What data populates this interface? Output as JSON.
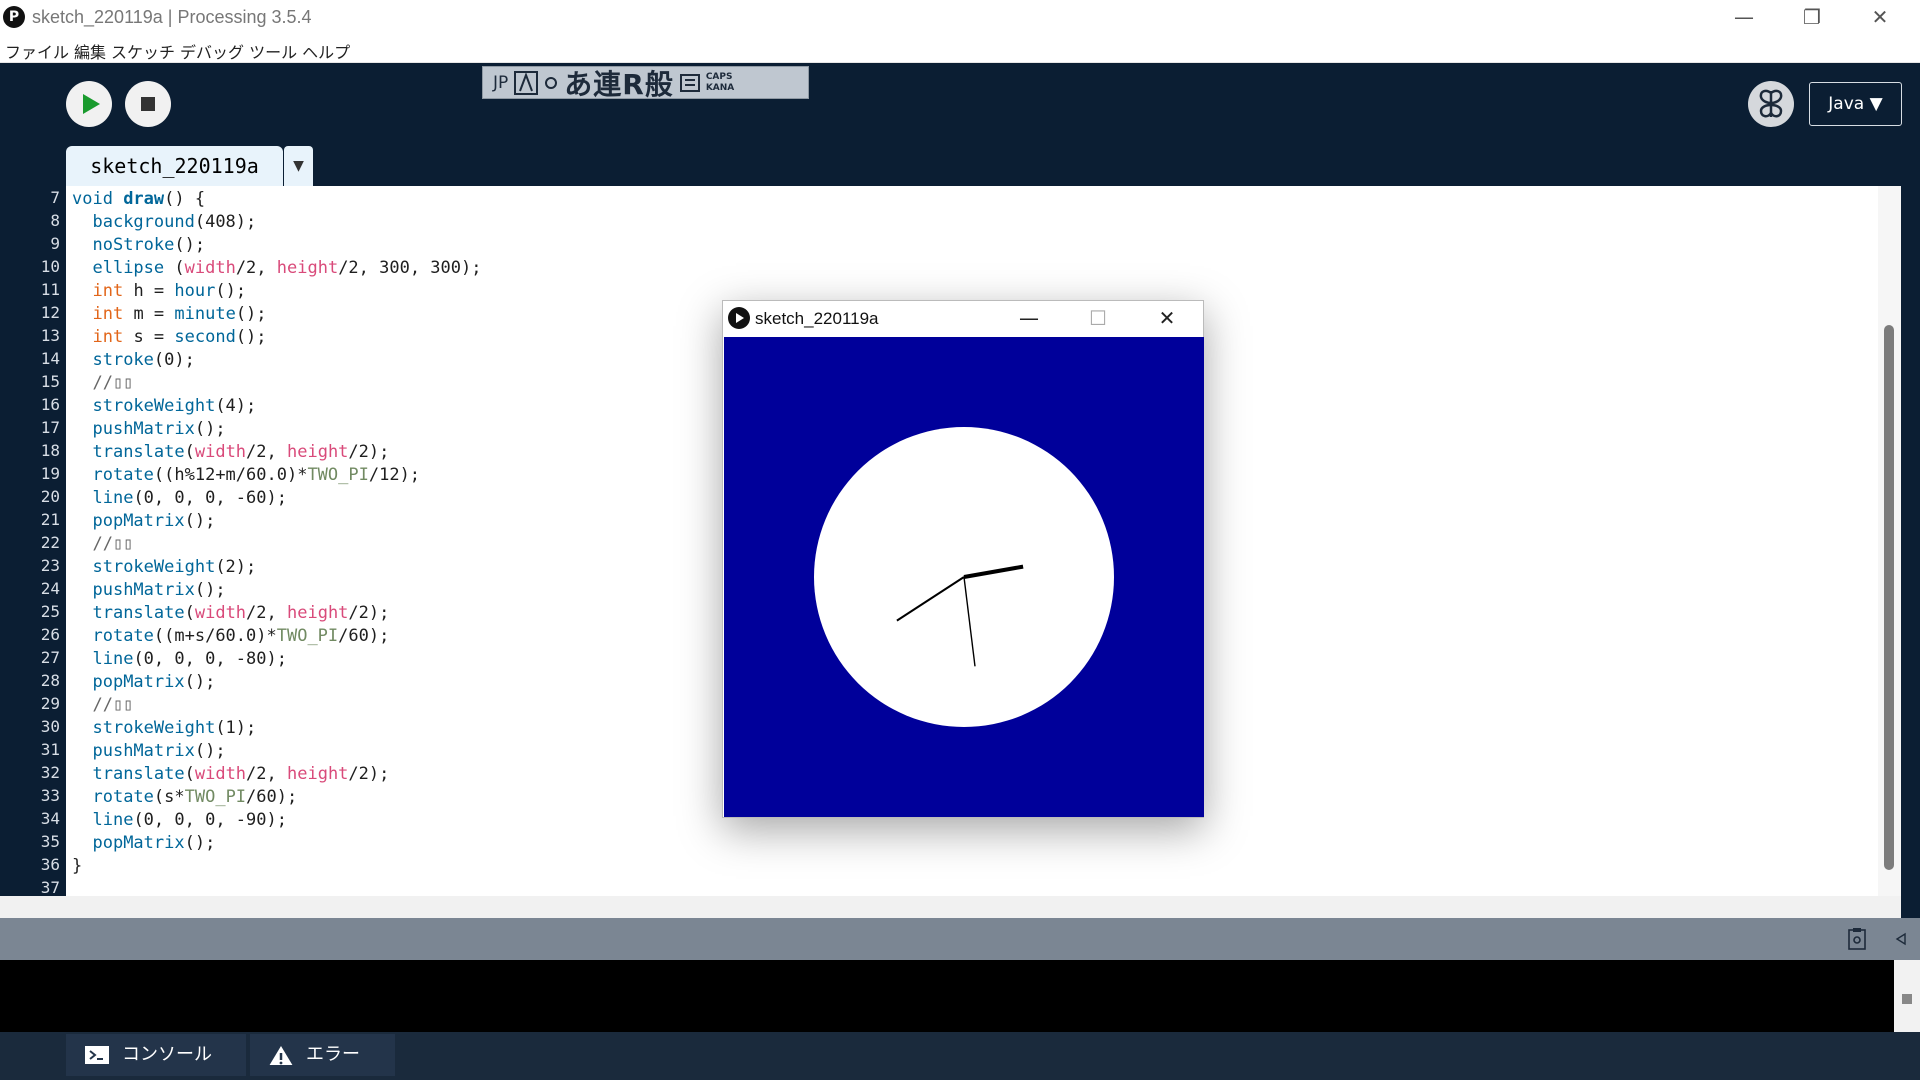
{
  "window": {
    "app_icon": "P",
    "title": "sketch_220119a | Processing 3.5.4",
    "minimize": "—",
    "restore": "❐",
    "close": "✕"
  },
  "menu": [
    "ファイル",
    "編集",
    "スケッチ",
    "デバッグ",
    "ツール",
    "ヘルプ"
  ],
  "toolbar": {
    "run_icon": "play-icon",
    "stop_icon": "stop-icon",
    "mode": "Java ▼",
    "debug_icon": "butterfly-icon"
  },
  "ime": {
    "lang": "JP",
    "mode_chars": "あ連R般",
    "caps": "CAPS",
    "kana": "KANA"
  },
  "tab": {
    "name": "sketch_220119a",
    "menu": "▼"
  },
  "editor": {
    "line_numbers": [
      "7",
      "8",
      "9",
      "10",
      "11",
      "12",
      "13",
      "14",
      "15",
      "16",
      "17",
      "18",
      "19",
      "20",
      "21",
      "22",
      "23",
      "24",
      "25",
      "26",
      "27",
      "28",
      "29",
      "30",
      "31",
      "32",
      "33",
      "34",
      "35",
      "36",
      "37"
    ],
    "lines": [
      [
        {
          "t": "void ",
          "c": "fn"
        },
        {
          "t": "draw",
          "c": "def"
        },
        {
          "t": "() {",
          "c": ""
        }
      ],
      [
        {
          "t": "  ",
          "c": ""
        },
        {
          "t": "background",
          "c": "fn"
        },
        {
          "t": "(408);",
          "c": ""
        }
      ],
      [
        {
          "t": "  ",
          "c": ""
        },
        {
          "t": "noStroke",
          "c": "fn"
        },
        {
          "t": "();",
          "c": ""
        }
      ],
      [
        {
          "t": "  ",
          "c": ""
        },
        {
          "t": "ellipse",
          "c": "fn"
        },
        {
          "t": " (",
          "c": ""
        },
        {
          "t": "width",
          "c": "var"
        },
        {
          "t": "/2, ",
          "c": ""
        },
        {
          "t": "height",
          "c": "var"
        },
        {
          "t": "/2, 300, 300);",
          "c": ""
        }
      ],
      [
        {
          "t": "  ",
          "c": ""
        },
        {
          "t": "int",
          "c": "kw"
        },
        {
          "t": " h = ",
          "c": ""
        },
        {
          "t": "hour",
          "c": "fn"
        },
        {
          "t": "();",
          "c": ""
        }
      ],
      [
        {
          "t": "  ",
          "c": ""
        },
        {
          "t": "int",
          "c": "kw"
        },
        {
          "t": " m = ",
          "c": ""
        },
        {
          "t": "minute",
          "c": "fn"
        },
        {
          "t": "();",
          "c": ""
        }
      ],
      [
        {
          "t": "  ",
          "c": ""
        },
        {
          "t": "int",
          "c": "kw"
        },
        {
          "t": " s = ",
          "c": ""
        },
        {
          "t": "second",
          "c": "fn"
        },
        {
          "t": "();",
          "c": ""
        }
      ],
      [
        {
          "t": "  ",
          "c": ""
        },
        {
          "t": "stroke",
          "c": "fn"
        },
        {
          "t": "(0);",
          "c": ""
        }
      ],
      [
        {
          "t": "  //▯▯",
          "c": "cmt"
        }
      ],
      [
        {
          "t": "  ",
          "c": ""
        },
        {
          "t": "strokeWeight",
          "c": "fn"
        },
        {
          "t": "(4);",
          "c": ""
        }
      ],
      [
        {
          "t": "  ",
          "c": ""
        },
        {
          "t": "pushMatrix",
          "c": "fn"
        },
        {
          "t": "();",
          "c": ""
        }
      ],
      [
        {
          "t": "  ",
          "c": ""
        },
        {
          "t": "translate",
          "c": "fn"
        },
        {
          "t": "(",
          "c": ""
        },
        {
          "t": "width",
          "c": "var"
        },
        {
          "t": "/2, ",
          "c": ""
        },
        {
          "t": "height",
          "c": "var"
        },
        {
          "t": "/2);",
          "c": ""
        }
      ],
      [
        {
          "t": "  ",
          "c": ""
        },
        {
          "t": "rotate",
          "c": "fn"
        },
        {
          "t": "((h%12+m/60.0)*",
          "c": ""
        },
        {
          "t": "TWO_PI",
          "c": "const"
        },
        {
          "t": "/12);",
          "c": ""
        }
      ],
      [
        {
          "t": "  ",
          "c": ""
        },
        {
          "t": "line",
          "c": "fn"
        },
        {
          "t": "(0, 0, 0, -60);",
          "c": ""
        }
      ],
      [
        {
          "t": "  ",
          "c": ""
        },
        {
          "t": "popMatrix",
          "c": "fn"
        },
        {
          "t": "();",
          "c": ""
        }
      ],
      [
        {
          "t": "  //▯▯",
          "c": "cmt"
        }
      ],
      [
        {
          "t": "  ",
          "c": ""
        },
        {
          "t": "strokeWeight",
          "c": "fn"
        },
        {
          "t": "(2);",
          "c": ""
        }
      ],
      [
        {
          "t": "  ",
          "c": ""
        },
        {
          "t": "pushMatrix",
          "c": "fn"
        },
        {
          "t": "();",
          "c": ""
        }
      ],
      [
        {
          "t": "  ",
          "c": ""
        },
        {
          "t": "translate",
          "c": "fn"
        },
        {
          "t": "(",
          "c": ""
        },
        {
          "t": "width",
          "c": "var"
        },
        {
          "t": "/2, ",
          "c": ""
        },
        {
          "t": "height",
          "c": "var"
        },
        {
          "t": "/2);",
          "c": ""
        }
      ],
      [
        {
          "t": "  ",
          "c": ""
        },
        {
          "t": "rotate",
          "c": "fn"
        },
        {
          "t": "((m+s/60.0)*",
          "c": ""
        },
        {
          "t": "TWO_PI",
          "c": "const"
        },
        {
          "t": "/60);",
          "c": ""
        }
      ],
      [
        {
          "t": "  ",
          "c": ""
        },
        {
          "t": "line",
          "c": "fn"
        },
        {
          "t": "(0, 0, 0, -80);",
          "c": ""
        }
      ],
      [
        {
          "t": "  ",
          "c": ""
        },
        {
          "t": "popMatrix",
          "c": "fn"
        },
        {
          "t": "();",
          "c": ""
        }
      ],
      [
        {
          "t": "  //▯▯",
          "c": "cmt"
        }
      ],
      [
        {
          "t": "  ",
          "c": ""
        },
        {
          "t": "strokeWeight",
          "c": "fn"
        },
        {
          "t": "(1);",
          "c": ""
        }
      ],
      [
        {
          "t": "  ",
          "c": ""
        },
        {
          "t": "pushMatrix",
          "c": "fn"
        },
        {
          "t": "();",
          "c": ""
        }
      ],
      [
        {
          "t": "  ",
          "c": ""
        },
        {
          "t": "translate",
          "c": "fn"
        },
        {
          "t": "(",
          "c": ""
        },
        {
          "t": "width",
          "c": "var"
        },
        {
          "t": "/2, ",
          "c": ""
        },
        {
          "t": "height",
          "c": "var"
        },
        {
          "t": "/2);",
          "c": ""
        }
      ],
      [
        {
          "t": "  ",
          "c": ""
        },
        {
          "t": "rotate",
          "c": "fn"
        },
        {
          "t": "(s*",
          "c": ""
        },
        {
          "t": "TWO_PI",
          "c": "const"
        },
        {
          "t": "/60);",
          "c": ""
        }
      ],
      [
        {
          "t": "  ",
          "c": ""
        },
        {
          "t": "line",
          "c": "fn"
        },
        {
          "t": "(0, 0, 0, -90);",
          "c": ""
        }
      ],
      [
        {
          "t": "  ",
          "c": ""
        },
        {
          "t": "popMatrix",
          "c": "fn"
        },
        {
          "t": "();",
          "c": ""
        }
      ],
      [
        {
          "t": "}",
          "c": ""
        }
      ],
      [
        {
          "t": "",
          "c": ""
        }
      ]
    ]
  },
  "console_tabs": {
    "console": "コンソール",
    "errors": "エラー"
  },
  "sketch_window": {
    "title": "sketch_220119a",
    "minimize": "—",
    "maximize": "☐",
    "close": "✕",
    "background": "#00009a",
    "face": "#ffffff",
    "hands_deg": {
      "hour": 80,
      "minute": 237,
      "second": 173
    }
  },
  "colors": {
    "accent_run": "#1a9b2e"
  }
}
